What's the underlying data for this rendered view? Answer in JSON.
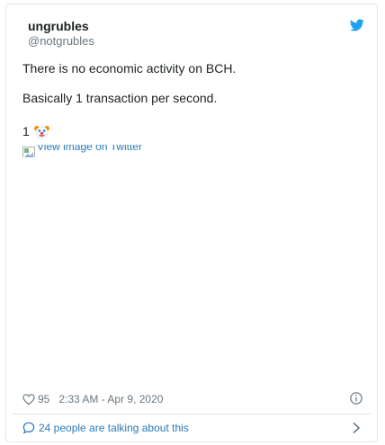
{
  "author": {
    "display_name": "ungrubles",
    "handle": "@notgrubles"
  },
  "tweet": {
    "paragraph_1": "There is no economic activity on BCH.",
    "paragraph_2": "Basically 1 transaction per second.",
    "paragraph_3": "1",
    "emoji": "clown-face-emoji",
    "image_alt": "View image on Twitter"
  },
  "footer": {
    "like_count": "95",
    "timestamp": "2:33 AM - Apr 9, 2020"
  },
  "conversation": {
    "label": "24 people are talking about this"
  },
  "icons": {
    "brand": "twitter-bird-icon",
    "like": "heart-icon",
    "info": "info-icon",
    "reply": "speech-bubble-icon",
    "more": "chevron-right-icon"
  },
  "colors": {
    "twitter_blue": "#1da1f2",
    "link_blue": "#2b7bb9",
    "text_primary": "#1c2022",
    "text_secondary": "#697882",
    "border": "#e1e8ed"
  }
}
